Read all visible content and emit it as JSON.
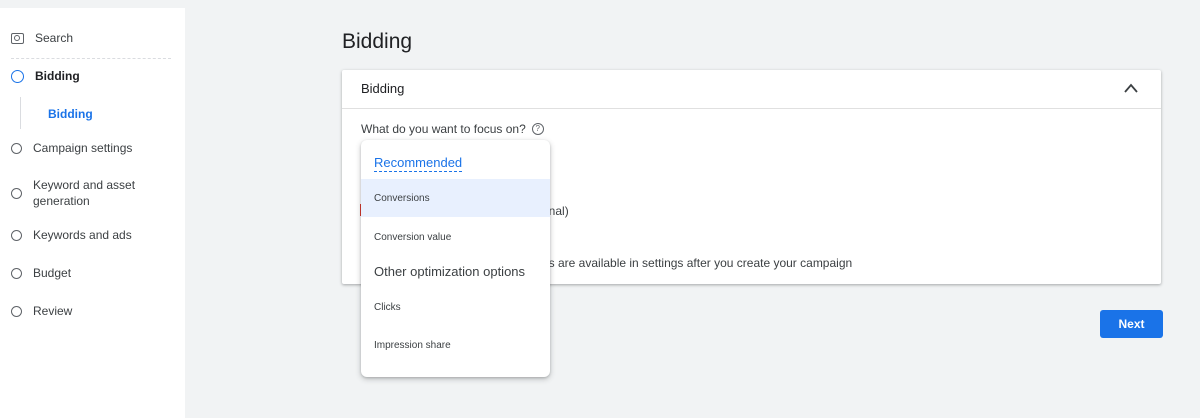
{
  "sidebar": {
    "search_label": "Search",
    "steps": [
      {
        "label": "Bidding"
      },
      {
        "label": "Campaign settings"
      },
      {
        "label": "Keyword and asset generation"
      },
      {
        "label": "Keywords and ads"
      },
      {
        "label": "Budget"
      },
      {
        "label": "Review"
      }
    ],
    "sub_item": "Bidding"
  },
  "main": {
    "page_title": "Bidding",
    "card": {
      "title": "Bidding",
      "focus_question": "What do you want to focus on?",
      "partial_text_1": "onal)",
      "partial_text_2": "os are available in settings after you create your campaign"
    },
    "dropdown": {
      "recommended_heading": "Recommended",
      "recommended_options": [
        "Conversions",
        "Conversion value"
      ],
      "other_heading": "Other optimization options",
      "other_options": [
        "Clicks",
        "Impression share"
      ],
      "selected": "Conversions"
    },
    "next_label": "Next"
  },
  "colors": {
    "accent": "#1a73e8",
    "selected_bg": "#e8f0fe",
    "page_bg": "#f1f3f4"
  }
}
